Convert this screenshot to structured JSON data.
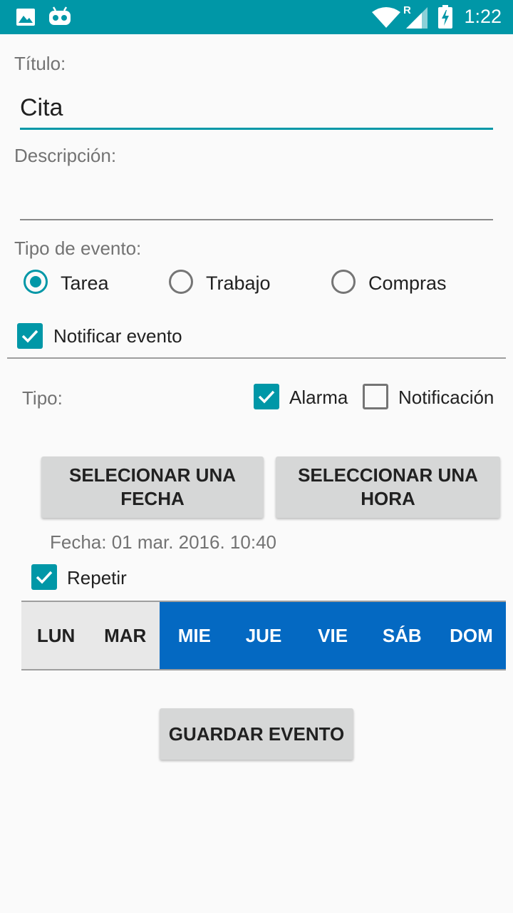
{
  "status_bar": {
    "time": "1:22",
    "icons": [
      "image-icon",
      "android-icon",
      "wifi-icon",
      "signal-icon",
      "battery-charging-icon"
    ],
    "roaming_letter": "R"
  },
  "form": {
    "title_label": "Título:",
    "title_value": "Cita",
    "description_label": "Descripción:",
    "description_value": "",
    "event_type_label": "Tipo de evento:",
    "event_types": [
      {
        "label": "Tarea",
        "selected": true
      },
      {
        "label": "Trabajo",
        "selected": false
      },
      {
        "label": "Compras",
        "selected": false
      }
    ],
    "notify_label": "Notificar evento",
    "notify_checked": true,
    "type_label": "Tipo:",
    "alarm_label": "Alarma",
    "alarm_checked": true,
    "notification_label": "Notificación",
    "notification_checked": false,
    "date_button": {
      "line1": "SELECIONAR UNA",
      "line2": "FECHA"
    },
    "time_button": {
      "line1": "SELECCIONAR UNA",
      "line2": "HORA"
    },
    "date_text": "Fecha: 01 mar. 2016. 10:40",
    "repeat_label": "Repetir",
    "repeat_checked": true,
    "days": [
      {
        "label": "LUN",
        "selected": false
      },
      {
        "label": "MAR",
        "selected": false
      },
      {
        "label": "MIE",
        "selected": true
      },
      {
        "label": "JUE",
        "selected": true
      },
      {
        "label": "VIE",
        "selected": true
      },
      {
        "label": "SÁB",
        "selected": true
      },
      {
        "label": "DOM",
        "selected": true
      }
    ],
    "save_button": "GUARDAR EVENTO"
  },
  "colors": {
    "accent": "#0097a7",
    "day_selected": "#0469c2",
    "day_unselected": "#e8e8e8",
    "button": "#d6d7d7"
  }
}
